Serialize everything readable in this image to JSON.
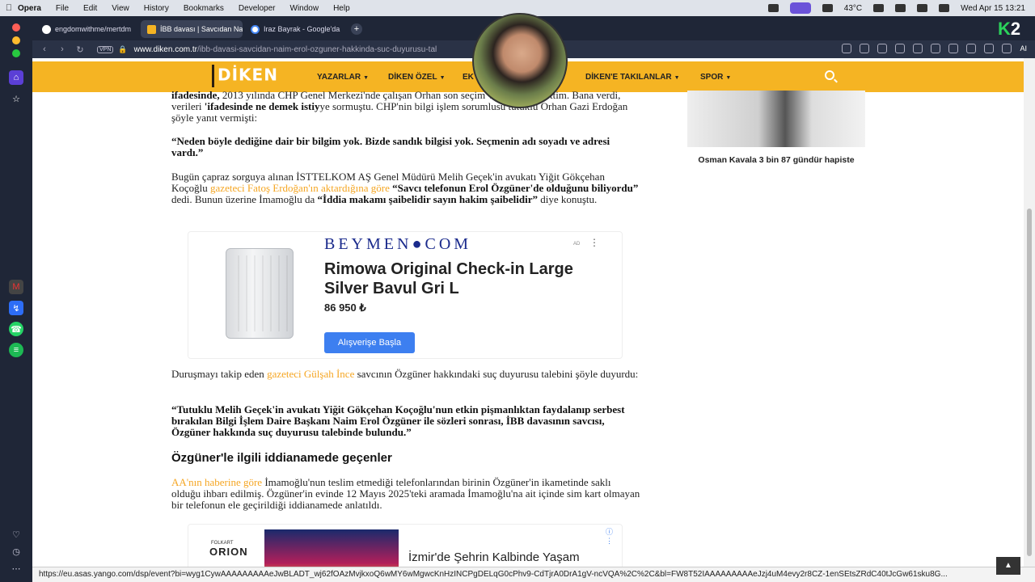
{
  "menubar": {
    "items": [
      "Opera",
      "File",
      "Edit",
      "View",
      "History",
      "Bookmarks",
      "Developer",
      "Window",
      "Help"
    ],
    "temp": "43°C",
    "clock": "Wed Apr 15  13:21"
  },
  "tabs": [
    {
      "label": "engdomwithme/mertdm"
    },
    {
      "label": "İBB davası | Savcıdan Na"
    },
    {
      "label": "Iraz Bayrak - Google'da"
    }
  ],
  "browser": {
    "vpn": "VPN",
    "url_domain": "www.diken.com.tr",
    "url_path": "/ibb-davasi-savcidan-naim-erol-ozguner-hakkinda-suc-duyurusu-tal",
    "ai_label": "AI",
    "brand_k": "K",
    "brand_2": "2"
  },
  "site": {
    "logo": "DİKEN",
    "nav": [
      "YAZARLAR",
      "DİKEN ÖZEL",
      "EK",
      "DİKEN'E TAKILANLAR",
      "SPOR"
    ]
  },
  "article": {
    "p1_a": "ifadesinde,",
    "p1_b": " 2013 yılında CHP Genel Merkezi'nde çalışan Orhan",
    "p1_c": " son seçim verisini talep ettim. Bana verdi, verileri ",
    "p1_d": "'ifadesinde ne demek istiy",
    "p1_e": "ye sormuştu. CHP'nin bilgi işlem sorumlusu tutuklu Orhan Gazi Erdoğan şöyle yanıt vermişti:",
    "q1": "“Neden böyle dediğine dair bir bilgim yok. Bizde sandık bilgisi yok. Seçmenin adı soyadı ve adresi vardı.”",
    "p2_a": "Bugün çapraz sorguya alınan İSTTELKOM AŞ Genel Müdürü Melih Geçek'in avukatı Yiğit Gökçehan Koçoğlu ",
    "p2_link": "gazeteci Fatoş Erdoğan'ın aktardığına göre",
    "p2_b": " “Savcı telefonun Erol Özgüner'de olduğunu biliyordu”",
    "p2_c": " dedi. Bunun üzerine İmamoğlu da ",
    "p2_d": "“İddia makamı şaibelidir sayın hakim şaibelidir”",
    "p2_e": " diye konuştu.",
    "p3_a": "Duruşmayı takip eden ",
    "p3_link": "gazeteci Gülşah İnce",
    "p3_b": " savcının Özgüner hakkındaki suç duyurusu talebini şöyle duyurdu:",
    "q2": "“Tutuklu Melih Geçek'in avukatı Yiğit Gökçehan Koçoğlu'nun etkin pişmanlıktan faydalanıp serbest bırakılan Bilgi İşlem Daire Başkanı Naim Erol Özgüner ile sözleri sonrası, İBB davasının savcısı, Özgüner hakkında suç duyurusu talebinde bulundu.”",
    "h2": "Özgüner'le ilgili iddianamede geçenler",
    "p4_link": "AA'nın haberine göre",
    "p4_b": " İmamoğlu'nun teslim etmediği telefonlarından birinin Özgüner'in ikametinde saklı olduğu ihbarı edilmiş. Özgüner'in evinde 12 Mayıs 2025'teki aramada İmamoğlu'na ait içinde sim kart olmayan bir telefonun ele geçirildiği iddianamede anlatıldı."
  },
  "ad": {
    "brand": "BEYMEN●COM",
    "tag": "AD",
    "title": "Rimowa Original Check-in Large Silver Bavul Gri L",
    "price": "86 950 ₺",
    "button": "Alışverişe Başla"
  },
  "ad2": {
    "folk": "FOLKART",
    "brand": "ORION",
    "text": "İzmir'de Şehrin Kalbinde Yaşam"
  },
  "sidebar": {
    "caption": "Osman Kavala 3 bin 87 gündür hapiste"
  },
  "status": {
    "url": "https://eu.asas.yango.com/dsp/event?bi=wyg1CywAAAAAAAAAeJwBLADT_wj62fOAzMvjkxoQ6wMY6wMgwcKnHzINCPgDELqG0cPhv9-CdTjrA0DrA1gV-ncVQA%2C%2C&bl=FW8T52IAAAAAAAAAeJzj4uM4evy2r8CZ-1enSEtsZRdC40tJcGw61sku8G..."
  }
}
